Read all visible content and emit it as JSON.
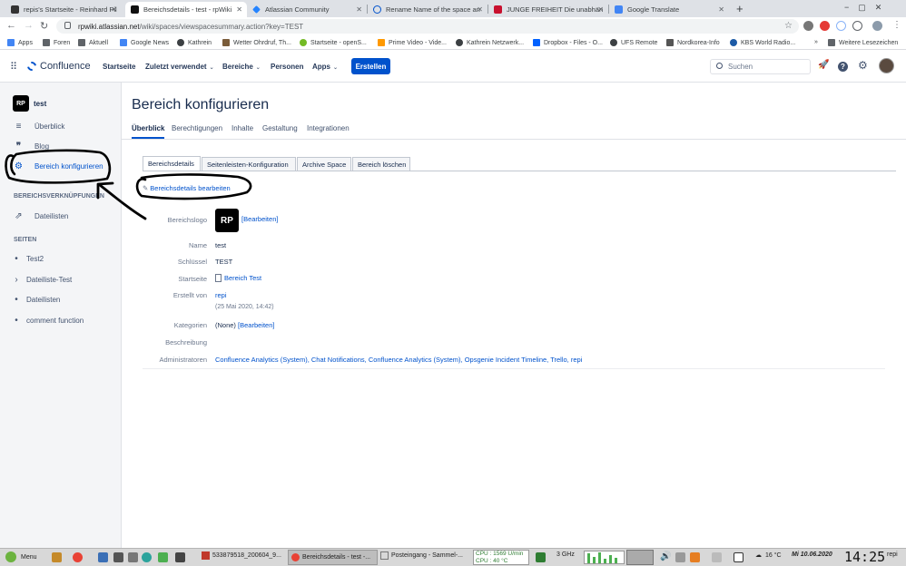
{
  "browser": {
    "tabs": [
      {
        "label": "repis's Startseite - Reinhard Pil",
        "active": false
      },
      {
        "label": "Bereichsdetails - test - rpWiki",
        "active": true
      },
      {
        "label": "Atlassian Community",
        "active": false
      },
      {
        "label": "Rename Name of the space an",
        "active": false
      },
      {
        "label": "JUNGE FREIHEIT Die unabhän",
        "active": false
      },
      {
        "label": "Google Translate",
        "active": false
      }
    ],
    "new_tab": "+",
    "url_host": "rpwiki.atlassian.net",
    "url_path": "/wiki/spaces/viewspacesummary.action?key=TEST",
    "bookmarks": [
      "Apps",
      "Foren",
      "Aktuell",
      "Google News",
      "Kathrein",
      "Wetter Ohrdruf, Th...",
      "Startseite - openS...",
      "Prime Video - Vide...",
      "Kathrein Netzwerk...",
      "Dropbox - Files - O...",
      "UFS Remote",
      "Nordkorea-Info",
      "KBS World Radio...",
      "»",
      "Weitere Lesezeichen"
    ],
    "accent_colors": {
      "tab_bg": "#dee1e6",
      "brand": "#0052cc"
    }
  },
  "header": {
    "logo": "Confluence",
    "nav": [
      "Startseite",
      "Zuletzt verwendet",
      "Bereiche",
      "Personen",
      "Apps"
    ],
    "create": "Erstellen",
    "search_placeholder": "Suchen"
  },
  "sidebar": {
    "space_name": "test",
    "items": [
      {
        "label": "Überblick",
        "icon": "overview-icon"
      },
      {
        "label": "Blog",
        "icon": "quote-icon"
      },
      {
        "label": "Bereich konfigurieren",
        "icon": "gear-icon"
      }
    ],
    "shortcuts_heading": "BEREICHSVERKNÜPFUNGEN",
    "shortcuts": [
      "Dateilisten"
    ],
    "pages_heading": "SEITEN",
    "pages": [
      "Test2",
      "Dateiliste-Test",
      "Dateilisten",
      "comment function"
    ]
  },
  "main": {
    "title": "Bereich konfigurieren",
    "tabs": [
      "Überblick",
      "Berechtigungen",
      "Inhalte",
      "Gestaltung",
      "Integrationen"
    ],
    "subtabs": [
      "Bereichsdetails",
      "Seitenleisten-Konfiguration",
      "Archive Space",
      "Bereich löschen"
    ],
    "edit_link": "Bereichsdetails bearbeiten",
    "fields": {
      "logo_label": "Bereichslogo",
      "logo_edit": "[Bearbeiten]",
      "name_label": "Name",
      "name": "test",
      "key_label": "Schlüssel",
      "key": "TEST",
      "home_label": "Startseite",
      "home": "Bereich Test",
      "created_label": "Erstellt von",
      "created_by": "repi",
      "created_date": "(25 Mai 2020, 14:42)",
      "categories_label": "Kategorien",
      "categories": "(None)",
      "categories_edit": "[Bearbeiten]",
      "description_label": "Beschreibung",
      "admins_label": "Administratoren",
      "admins": "Confluence Analytics (System), Chat Notifications, Confluence Analytics (System), Opsgenie Incident Timeline, Trello, repi"
    }
  },
  "taskbar": {
    "menu": "Menu",
    "windows": [
      "533879518_200604_9...",
      "Bereichsdetails - test -...",
      "Posteingang - Sammel-..."
    ],
    "cpu_freq": "CPU : 1569 U/min",
    "cpu_temp": "CPU : 40 °C",
    "ghz": "3 GHz",
    "weather": "16 °C",
    "date": "Mi 10.06.2020",
    "time": "14:25",
    "user": "repi"
  }
}
